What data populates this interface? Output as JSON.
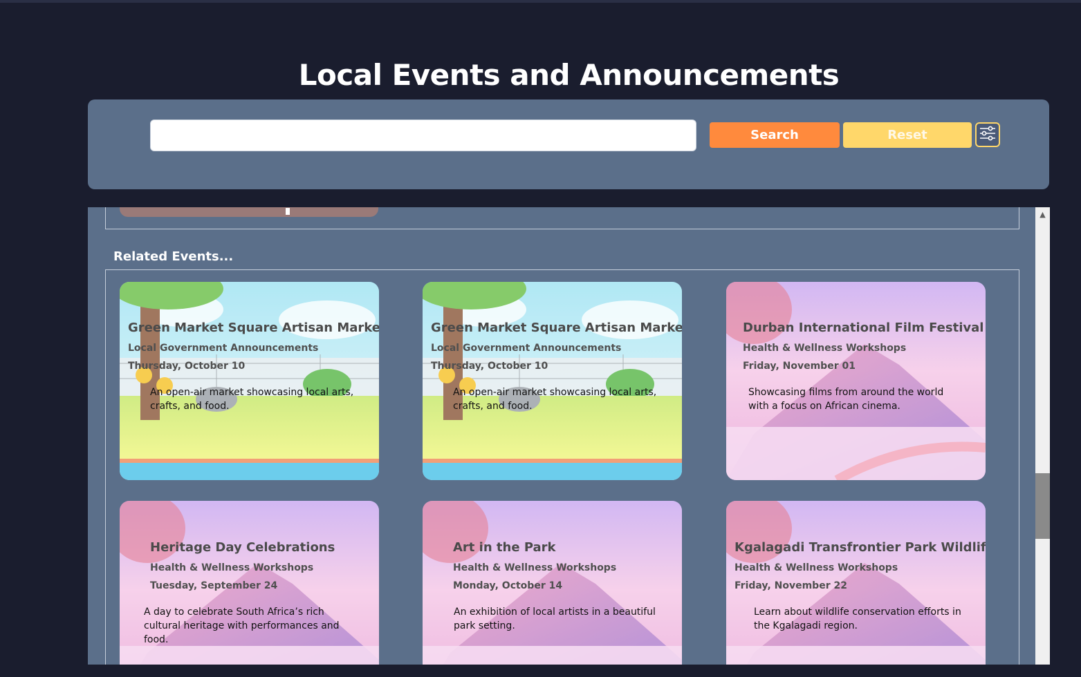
{
  "page": {
    "title": "Local Events and Announcements"
  },
  "search": {
    "value": "",
    "placeholder": "",
    "search_label": "Search",
    "reset_label": "Reset",
    "filter_icon": "sliders-icon"
  },
  "related": {
    "heading": "Related Events...",
    "events": [
      {
        "title": "Green Market Square Artisan Market",
        "category": "Local Government Announcements",
        "date": "Thursday, October 10",
        "description": "An open-air market showcasing local arts, crafts, and food.",
        "image": "park-illustration"
      },
      {
        "title": "Green Market Square Artisan Market",
        "category": "Local Government Announcements",
        "date": "Thursday, October 10",
        "description": "An open-air market showcasing local arts, crafts, and food.",
        "image": "park-illustration"
      },
      {
        "title": "Durban International Film Festival",
        "category": "Health & Wellness Workshops",
        "date": "Friday, November 01",
        "description": "Showcasing films from around the world with a focus on African cinema.",
        "image": "pink-mountain-illustration"
      },
      {
        "title": "Heritage Day Celebrations",
        "category": "Health & Wellness Workshops",
        "date": "Tuesday, September 24",
        "description": "A day to celebrate South Africa’s rich cultural heritage with performances and food.",
        "image": "pink-mountain-illustration"
      },
      {
        "title": "Art in the Park",
        "category": "Health & Wellness Workshops",
        "date": "Monday, October 14",
        "description": "An exhibition of local artists in a beautiful park setting.",
        "image": "pink-mountain-illustration"
      },
      {
        "title": "Kgalagadi Transfrontier Park Wildlif",
        "category": "Health & Wellness Workshops",
        "date": "Friday, November 22",
        "description": "Learn about wildlife conservation efforts in the Kgalagadi region.",
        "image": "pink-mountain-illustration"
      }
    ]
  },
  "colors": {
    "background": "#1a1d2e",
    "panel": "#5b6f8a",
    "search_button": "#ff8a3d",
    "reset_button": "#ffd76a"
  }
}
